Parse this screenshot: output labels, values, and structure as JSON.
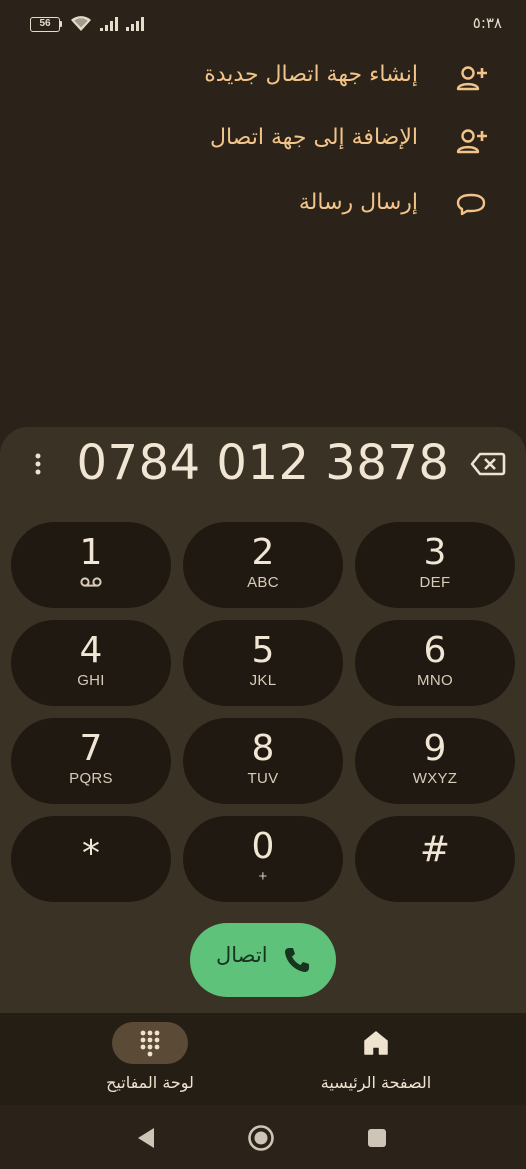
{
  "status_bar": {
    "battery_level": "56",
    "time": "٥:٣٨"
  },
  "actions": [
    {
      "label": "إنشاء جهة اتصال جديدة",
      "icon": "person-add-icon"
    },
    {
      "label": "الإضافة إلى جهة اتصال",
      "icon": "person-add-icon"
    },
    {
      "label": "إرسال رسالة",
      "icon": "message-icon"
    }
  ],
  "dialer": {
    "number": "0784 012 3878",
    "keys": [
      {
        "digit": "1",
        "letters": "",
        "icon": "voicemail-icon"
      },
      {
        "digit": "2",
        "letters": "ABC"
      },
      {
        "digit": "3",
        "letters": "DEF"
      },
      {
        "digit": "4",
        "letters": "GHI"
      },
      {
        "digit": "5",
        "letters": "JKL"
      },
      {
        "digit": "6",
        "letters": "MNO"
      },
      {
        "digit": "7",
        "letters": "PQRS"
      },
      {
        "digit": "8",
        "letters": "TUV"
      },
      {
        "digit": "9",
        "letters": "WXYZ"
      },
      {
        "digit": "*",
        "letters": ""
      },
      {
        "digit": "0",
        "letters": "+"
      },
      {
        "digit": "#",
        "letters": ""
      }
    ],
    "call_label": "اتصال"
  },
  "bottom_nav": {
    "keypad_label": "لوحة المفاتيح",
    "home_label": "الصفحة الرئيسية",
    "active": "keypad"
  },
  "colors": {
    "background": "#2b2319",
    "panel": "#3b3226",
    "key": "#1f1911",
    "accent_text": "#f2c48a",
    "call_green": "#5fc27a"
  }
}
